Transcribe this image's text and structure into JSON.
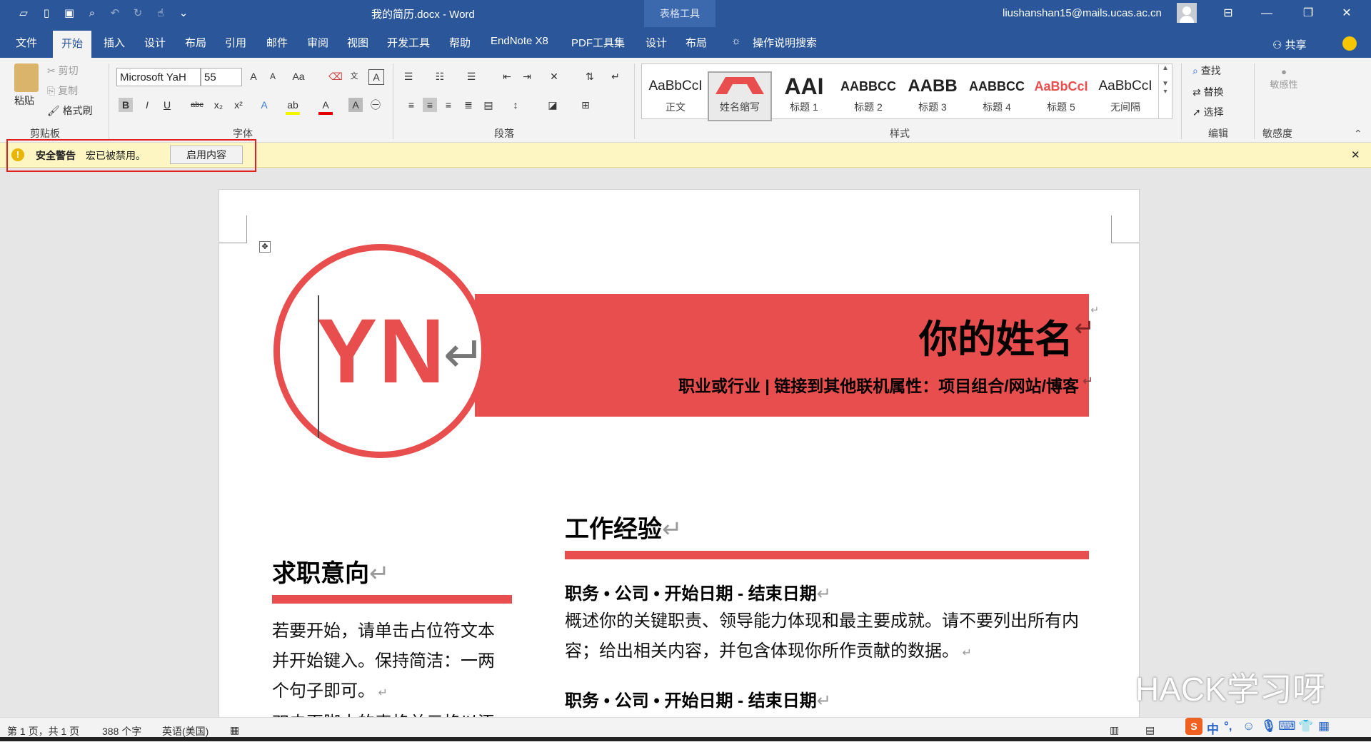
{
  "titlebar": {
    "doc_title": "我的简历.docx  -  Word",
    "context_tab": "表格工具",
    "user_email": "liushanshan15@mails.ucas.ac.cn",
    "accent": "#2b579a"
  },
  "tabs": [
    "文件",
    "开始",
    "插入",
    "设计",
    "布局",
    "引用",
    "邮件",
    "审阅",
    "视图",
    "开发工具",
    "帮助",
    "EndNote X8",
    "PDF工具集",
    "设计",
    "布局"
  ],
  "active_tab": "开始",
  "tell_me": "操作说明搜索",
  "share": "共享",
  "ribbon": {
    "clipboard": {
      "paste": "粘贴",
      "cut": "剪切",
      "copy": "复制",
      "format_painter": "格式刷",
      "label": "剪贴板"
    },
    "font": {
      "name": "Microsoft YaH",
      "size": "55",
      "label": "字体"
    },
    "paragraph": {
      "label": "段落"
    },
    "styles": {
      "label": "样式",
      "items": [
        {
          "preview": "AaBbCcI",
          "name": "正文"
        },
        {
          "preview": "",
          "name": "姓名缩写"
        },
        {
          "preview": "AAI",
          "name": "标题 1"
        },
        {
          "preview": "AABBCC",
          "name": "标题 2"
        },
        {
          "preview": "AABB",
          "name": "标题 3"
        },
        {
          "preview": "AABBCC",
          "name": "标题 4"
        },
        {
          "preview": "AaBbCcI",
          "name": "标题 5"
        },
        {
          "preview": "AaBbCcI",
          "name": "无间隔"
        }
      ]
    },
    "editing": {
      "find": "查找",
      "replace": "替换",
      "select": "选择",
      "label": "编辑"
    },
    "sensitivity": {
      "btn": "敏感性",
      "label": "敏感度"
    }
  },
  "message_bar": {
    "title": "安全警告",
    "text": "宏已被禁用。",
    "button": "启用内容"
  },
  "document": {
    "initials": "YN",
    "name": "你的姓名",
    "subtitle": "职业或行业 | 链接到其他联机属性：项目组合/网站/博客",
    "objective_title": "求职意向",
    "objective_lines": [
      "若要开始，请单击占位符文本",
      "并开始键入。保持简洁：一两",
      "个句子即可。"
    ],
    "objective_cut": "双击页脚中的表格单元格以添",
    "experience_title": "工作经验",
    "job1_head": "职务 • 公司 • 开始日期 - 结束日期",
    "job1_lines": [
      "概述你的关键职责、领导能力体现和最主要成就。请不要列出所有内",
      "容；给出相关内容，并包含体现你所作贡献的数据。"
    ],
    "job2_head": "职务 • 公司 • 开始日期 - 结束日期",
    "accent": "#e84e4e"
  },
  "status": {
    "page": "第 1 页，共 1 页",
    "words": "388 个字",
    "language": "英语(美国)"
  },
  "watermark": "HACK学习呀",
  "ime": {
    "lang": "中"
  }
}
